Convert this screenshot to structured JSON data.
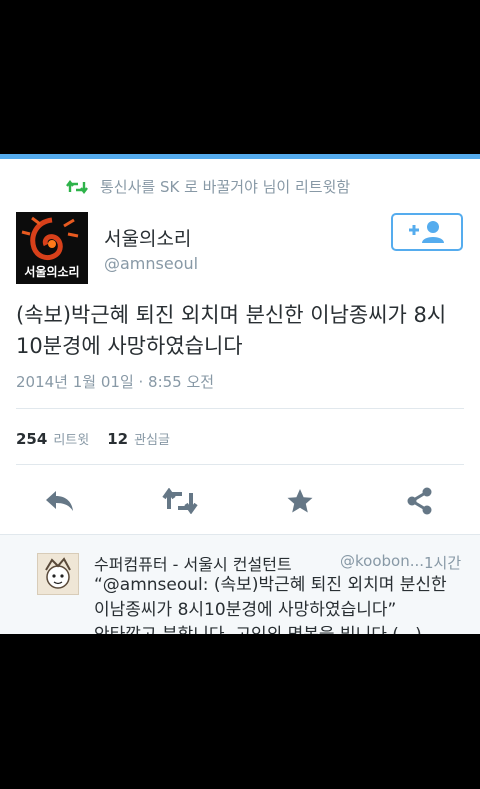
{
  "retweet_note": {
    "text": "통신사를 SK 로 바꿀거야 님이 리트윗함",
    "icon": "retweet-icon"
  },
  "tweet": {
    "avatar_label": "서울의소리",
    "name": "서울의소리",
    "handle": "@amnseoul",
    "text": "(속보)박근혜 퇴진 외치며 분신한 이남종씨가 8시10분경에 사망하였습니다",
    "timestamp": "2014년 1월 01일 · 8:55 오전",
    "retweet_count": "254",
    "retweet_label": "리트윗",
    "favorite_count": "12",
    "favorite_label": "관심글"
  },
  "follow_button": {
    "icon": "add-user-icon"
  },
  "actions": {
    "reply": "reply-icon",
    "retweet": "retweet-icon",
    "favorite": "star-icon",
    "share": "share-icon"
  },
  "reply": {
    "name": "수퍼컴퓨터 - 서울시 컨설턴트",
    "handle": "@koobon...",
    "time": "1시간",
    "text": "“@amnseoul: (속보)박근혜 퇴진 외치며 분신한\n이남종씨가 8시10분경에 사망하였습니다”\n안타깝고 분합니다. 고인의 명복을 빕니다 (...)"
  },
  "colors": {
    "accent": "#55acee",
    "text": "#292f33",
    "muted": "#8899a6"
  }
}
